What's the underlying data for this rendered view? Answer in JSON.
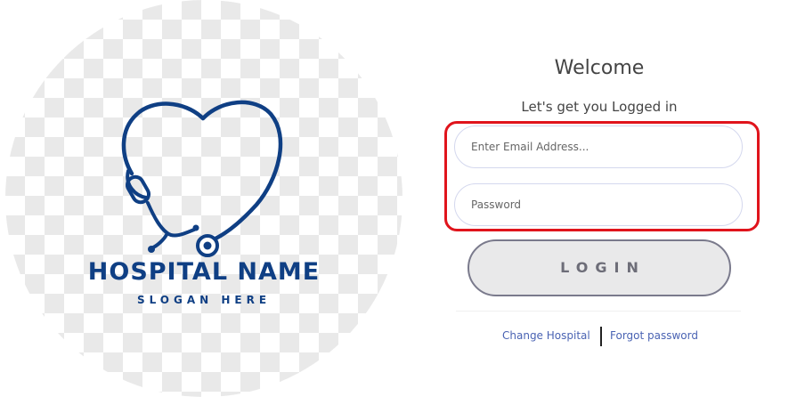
{
  "logo": {
    "hospital_name": "HOSPITAL NAME",
    "slogan": "SLOGAN HERE",
    "icon": "heart-stethoscope-icon",
    "brand_color": "#0f3f84"
  },
  "login": {
    "welcome": "Welcome",
    "subtitle": "Let's get you Logged in",
    "email_placeholder": "Enter Email Address...",
    "password_placeholder": "Password",
    "login_label": "LOGIN",
    "highlight_color": "#e0141c"
  },
  "links": {
    "change_hospital": "Change Hospital",
    "forgot_password": "Forgot password",
    "color": "#4a63b3"
  }
}
